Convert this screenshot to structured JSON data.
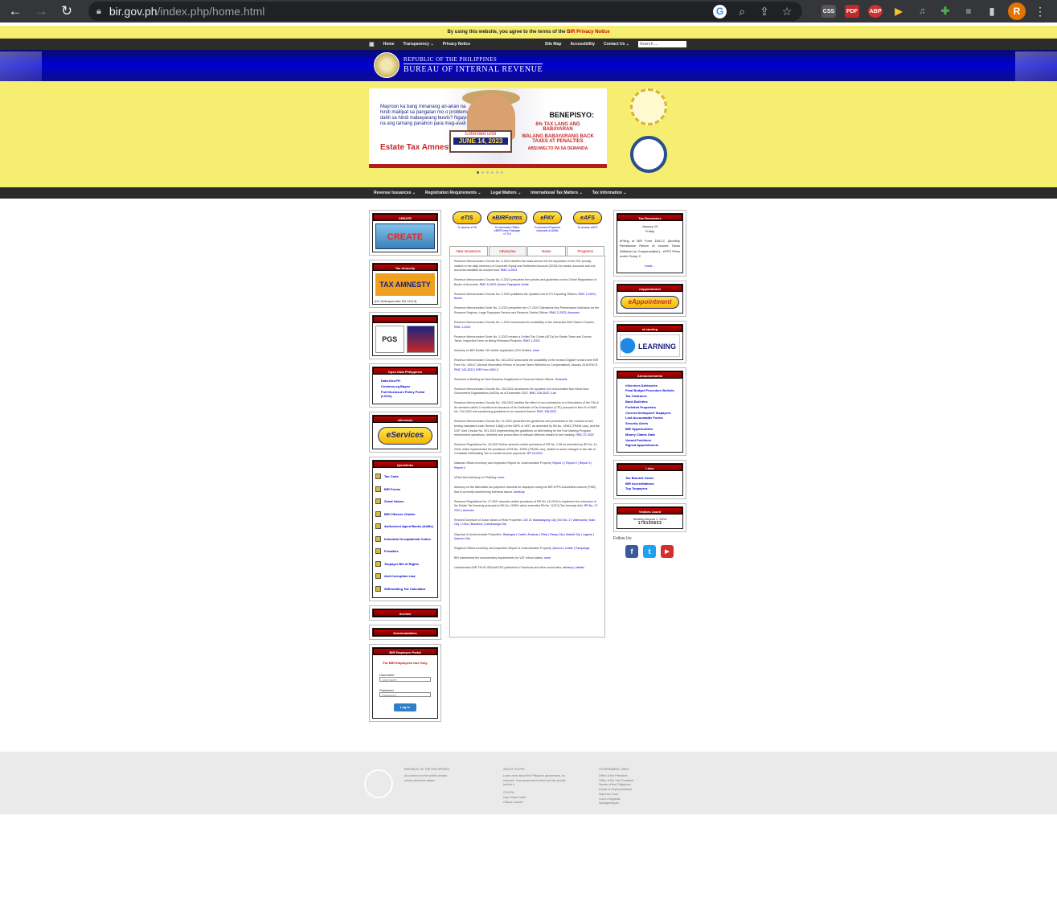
{
  "browser": {
    "url_host": "bir.gov.ph",
    "url_path": "/index.php/home.html",
    "avatar_letter": "R",
    "extensions": [
      "CSS",
      "PDF",
      "ABP",
      "▶",
      "♫",
      "✚",
      "≡",
      "▮"
    ]
  },
  "notice": {
    "text": "By using this website, you agree to the terms of the ",
    "link": "BIR Privacy Notice"
  },
  "topnav": {
    "items": [
      "Home",
      "Transparency ⌄",
      "Privacy Notice"
    ],
    "right": [
      "Site Map",
      "Accessibility",
      "Contact Us ⌄"
    ],
    "search_placeholder": "Search ..."
  },
  "agency": {
    "line1": "Republic of the Philippines",
    "line2": "Bureau of Internal Revenue"
  },
  "slide": {
    "left_text": "Mayroon ka bang minanang ari-arian na hindi mailipat sa pangalan mo o problema dahil sa hindi mabayarang buwis? Ngayon na ang tamang panahon para mag-avail ng",
    "left_bold": "hindi mabayarang buwis?",
    "left_title": "Estate Tax Amnesty",
    "sign_top": "Extended until",
    "sign_date": "JUNE 14, 2023",
    "right_title": "BENEPISYO:",
    "right_1": "6% TAX LANG ANG BABAYARAN",
    "right_2": "WALANG BABAYARANG BACK TAXES AT PENALTIES",
    "right_3": "ABSUWELTO PA SA DEMANDA"
  },
  "mainnav": {
    "items": [
      "Revenue Issuances ⌄",
      "Registration Requirements ⌄",
      "Legal Matters ⌄",
      "International Tax Matters ⌄",
      "Tax Information ⌄"
    ]
  },
  "left": {
    "create": {
      "header": "CREATE",
      "image": "CREATE"
    },
    "amnesty": {
      "header": "Tax Amnesty",
      "image": "TAX AMNESTY",
      "note": "[On Delinquencies RA 11213]"
    },
    "pgs": {
      "image": "PGS"
    },
    "opendata": {
      "header": "Open Data Philippines",
      "links": [
        "Data.Gov.PH",
        "Customs.eg.Bayan",
        "Full Disclosure Policy Portal (LGUs)"
      ]
    },
    "eservices": {
      "header": "eServices",
      "image": "eServices"
    },
    "quicklinks": {
      "header": "Quicklinks",
      "items": [
        "Tax Code",
        "BIR Forms",
        "Zonal Values",
        "BIR Citizens Charter",
        "Authorized Agent Banks (AABs)",
        "Industrial Occupational Codes",
        "Penalties",
        "Taxpayer Bill of Rights",
        "Anti-Corruption Law",
        "Withholding Tax Calculator"
      ]
    },
    "archive": {
      "header": "Archive"
    },
    "downloadables": {
      "header": "Downloadables"
    },
    "portal": {
      "header": "BIR Employee Portal",
      "notice": "For BIR Employees Use Only",
      "username_label": "Username",
      "username_ph": "Username",
      "password_label": "Password",
      "password_ph": "Password",
      "button": "Log In"
    }
  },
  "center": {
    "eicons": [
      {
        "logo": "eTIS",
        "caption": "To access eTIS"
      },
      {
        "logo": "eBIRForms",
        "caption": "To download Offline eBIRForms Package v7.9.0"
      },
      {
        "logo": "ePAY",
        "caption": "To access ePayment channels of AABs"
      },
      {
        "logo": "eAFS",
        "caption": "To access eAFS"
      }
    ],
    "tabs": [
      "New Issuances",
      "Advisories",
      "News",
      "Programs"
    ],
    "active_tab": "Advisories",
    "news": [
      {
        "text": "Revenue Memorandum Circular No. 4-2023 clarifies the basis amount for the imposition of the 20% penalty relative to the daily inventory of Corporate Equity and Settlement Account (CESA) for banks, accounts and sub accounts classified as unused fund.",
        "link": "RMC 4-2023"
      },
      {
        "text": "Revenue Memorandum Circular No. 5-2023 prescribes the policies and guidelines on the Online Registration of Books of Accounts.",
        "link": "RMC 5-2023 | Annex Taxpayers Guide"
      },
      {
        "text": "Revenue Memorandum Circular No. 2-2023 publishes the Updated List of FO Exporting Officers.",
        "link": "RMC 2-2023 | Annex"
      },
      {
        "text": "Revenue Memorandum Order No. 2-2023 prescribes the CY 2023 Operations Key Performance Indicators for the Revenue Regions, Large Taxpayers Service and Revenue District Offices.",
        "link": "RMO 2-2023 | Annexes"
      },
      {
        "text": "Revenue Memorandum Circular No. 1-2023 announces the availability of the Interactive BIR Citizen's Charter.",
        "link": "RMC 1-2023"
      },
      {
        "text": "Revenue Memorandum Order No. 1-2023 creates a Unified Tax Codes (ATCs) for Estate Taxes and Donors Taxes. Inspection Fees on Newly Released Products.",
        "link": "RMO 1-2023"
      },
      {
        "text": "Advisory on BIR Mobile TIN Verifier Application (TIN Verifier).",
        "link": "more"
      },
      {
        "text": "Revenue Memorandum Circular No. 143-2022 announces the availability of the revised Digital Format in line BIR Form No. 1604-C (Annual Information Return of Income Taxes Withheld on Compensation) January 2018 ENCS.",
        "link": "RMC 143-2022 | BIR Form 1604-C"
      },
      {
        "text": "Schedule of Briefing for New Business Registrants in Revenue District Offices.",
        "link": "Schedule"
      },
      {
        "text": "Revenue Memorandum Circular No. 139-2022 circularizes the Updated List of Accredited Non-Stock Non-Government Organizations (NGOs) as of December 2022.",
        "link": "RMC 139-2022 | List"
      },
      {
        "text": "Revenue Memorandum Circular No. 138-2022 clarifies the effect of non-submission of a Description of the TIN of its members within 3 months from issuance of its Certificate of Tax Exemption (CTE) pursuant to item III of RMC No. 134-2022 and sanctioning guidelines to be imposed thereof.",
        "link": "RMC 138-2022"
      },
      {
        "text": "Revenue Memorandum Circular No. 37-2022 prescribes the guidelines and procedures in the conduct of fuel testing mandated under Section 148(A) of the NIRC of 1997, as amended by RA No. 10963 (TRAIN Law), and the DOF Joint Circular No. 001-2021 implementing the guidelines on field testing for the Fuel Marking Program, enforcement operations, forfeiture and prosecution of relevant offenses related to fuel marking.",
        "link": "RMC 37-2022"
      },
      {
        "text": "Revenue Regulations No. 15-2022 further amends certain provisions of RR No. 2-98 as amended by RR No. 11-2018, which implemented the provisions of RA No. 10963 (TRAIN Law), relative to some changes in the rate of Creditable Withholding Tax on certain income payments.",
        "link": "RR 15-2022"
      },
      {
        "text": "National Offices Inventory and Inspection Report on Unserviceable Property.",
        "link": "Report 1 | Report 2 | Report 3 | Report 4"
      },
      {
        "text": "eFiled Alert Advisory on Phishing.",
        "link": "more"
      },
      {
        "text": "Advisory on the alternative tax payment channels for taxpayers using the BIR eFPS-UnionBank channel (PUB) that is currently experiencing technical issues.",
        "link": "Advisory"
      },
      {
        "text": "Revenue Regulations No. 17-2021 amends certain provisions of RR No. 16-2016 to implement the extension of the Estate Tax Amnesty pursuant to RA No. 11569, which amended RA No. 11213 (Tax Amnesty Act).",
        "link": "RR No. 17-2021 | Annexes"
      },
      {
        "text": "Revised Schedule of Zonal Values of Real Properties.",
        "link": "DO 21 Mandaluyong City | DO No. 17 Valenzuela | Iloilo City | Cebu | Bukidnon | Zamboanga City"
      },
      {
        "text": "Disposal of Unserviceable Properties.",
        "link": "Batangas | Cavite | Bulacan | Rizal | Pasay City | Makati City | Laguna | Quezon City"
      },
      {
        "text": "Regional Offices Inventory and Inspection Report of Unserviceable Property.",
        "link": "Quezon | Cavite | Pampanga"
      },
      {
        "text": "BIR streamlines the documentary requirements for VAT refund claims.",
        "link": "more"
      },
      {
        "text": "Unauthorized BIR TIN ID ISSUANCES published in Facebook and other social sites.",
        "link": "advisory | details"
      }
    ]
  },
  "right": {
    "taxreminders": {
      "header": "Tax Reminders",
      "date": "January 10",
      "day": "Friday",
      "text": "eFiling of BIR Form 1601-C (Monthly Remittance Return of Income Taxes Withheld on Compensation) - eFPS Filers under Group C",
      "more": "more..."
    },
    "eappointment": {
      "header": "eAppointment",
      "image": "eAppointment"
    },
    "elearning": {
      "header": "eLearning",
      "image": "LEARNING"
    },
    "announcements": {
      "header": "Announcements",
      "items": [
        "eServices Advisories",
        "Final Budget Procedure Bulletin",
        "Tax Clearance",
        "Bank Bulletins",
        "Forfeited Properties",
        "Correct Delinquent Taxpayers",
        "Lost Accountable Forms",
        "Security Alerts",
        "BIR Opportunities",
        "Money Claims Data",
        "Vacant Positions",
        "Signed Appointments"
      ]
    },
    "links": {
      "header": "Links",
      "items": [
        "Tax Bracket Cases",
        "BIR Accreditations",
        "Top Taxpayers"
      ]
    },
    "visitors": {
      "header": "Visitors Count",
      "since": "Starting August 1, 2014",
      "count": "178105653"
    },
    "follow": "Follow Us:"
  },
  "footer": {
    "col1_title": "REPUBLIC OF THE PHILIPPINES",
    "col1_text": "All content is in the public domain unless otherwise stated.",
    "col2_title": "ABOUT GOVPH",
    "col2_text": "Learn more about the Philippine government, its structure, how government works and the people behind it.",
    "col2_links": [
      "GOV.PH",
      "Open Data Portal",
      "Official Gazette"
    ],
    "col3_title": "GOVERNMENT LINKS",
    "col3_links": [
      "Office of the President",
      "Office of the Vice President",
      "Senate of the Philippines",
      "House of Representatives",
      "Supreme Court",
      "Court of Appeals",
      "Sandiganbayan"
    ]
  },
  "colors": {
    "notice_bg": "#f5ee70",
    "banner": "#0000d0",
    "header_red": "#c10000",
    "link": "#0000cc"
  }
}
